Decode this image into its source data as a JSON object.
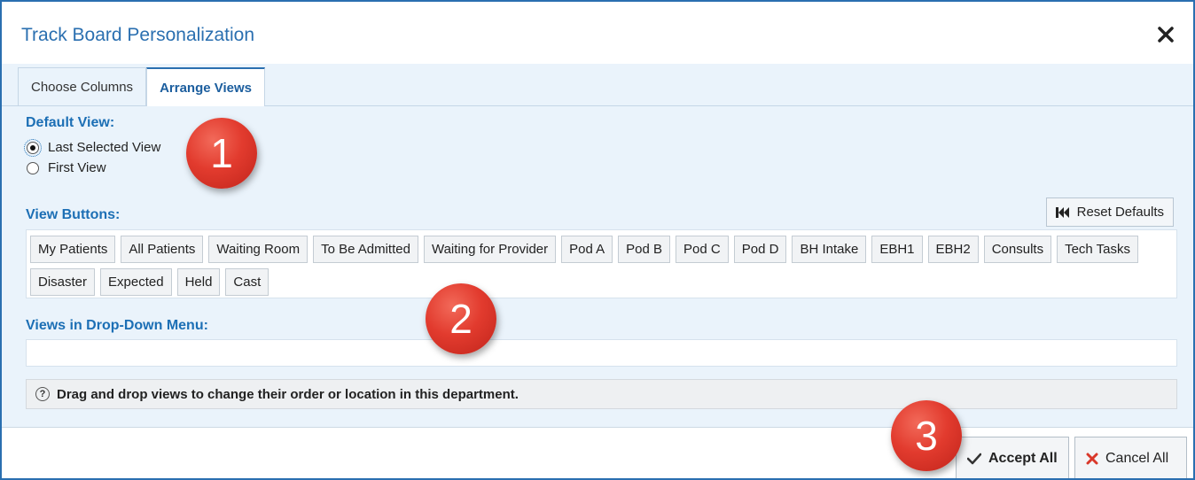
{
  "dialog": {
    "title": "Track Board Personalization",
    "close_icon": "close-icon"
  },
  "tabs": [
    {
      "label": "Choose Columns",
      "active": false
    },
    {
      "label": "Arrange Views",
      "active": true
    }
  ],
  "default_view": {
    "label": "Default View:",
    "options": [
      {
        "label": "Last Selected View",
        "checked": true
      },
      {
        "label": "First View",
        "checked": false
      }
    ]
  },
  "view_buttons": {
    "label": "View Buttons:",
    "reset_label": "Reset Defaults",
    "reset_icon": "skip-back-icon",
    "items": [
      "My Patients",
      "All Patients",
      "Waiting Room",
      "To Be Admitted",
      "Waiting for Provider",
      "Pod A",
      "Pod B",
      "Pod C",
      "Pod D",
      "BH Intake",
      "EBH1",
      "EBH2",
      "Consults",
      "Tech Tasks",
      "Disaster",
      "Expected",
      "Held",
      "Cast"
    ]
  },
  "dropdown_menu": {
    "label": "Views in Drop-Down Menu:"
  },
  "hint": {
    "text": "Drag and drop views to change their order or location in this department.",
    "icon": "help-icon"
  },
  "footer": {
    "accept_label": "Accept All",
    "cancel_label": "Cancel All"
  },
  "callouts": [
    "1",
    "2",
    "3"
  ],
  "colors": {
    "accent": "#2a6fb0",
    "section_label": "#1c6fb5",
    "badge": "#e23b2e",
    "cancel_x": "#d9382a"
  }
}
